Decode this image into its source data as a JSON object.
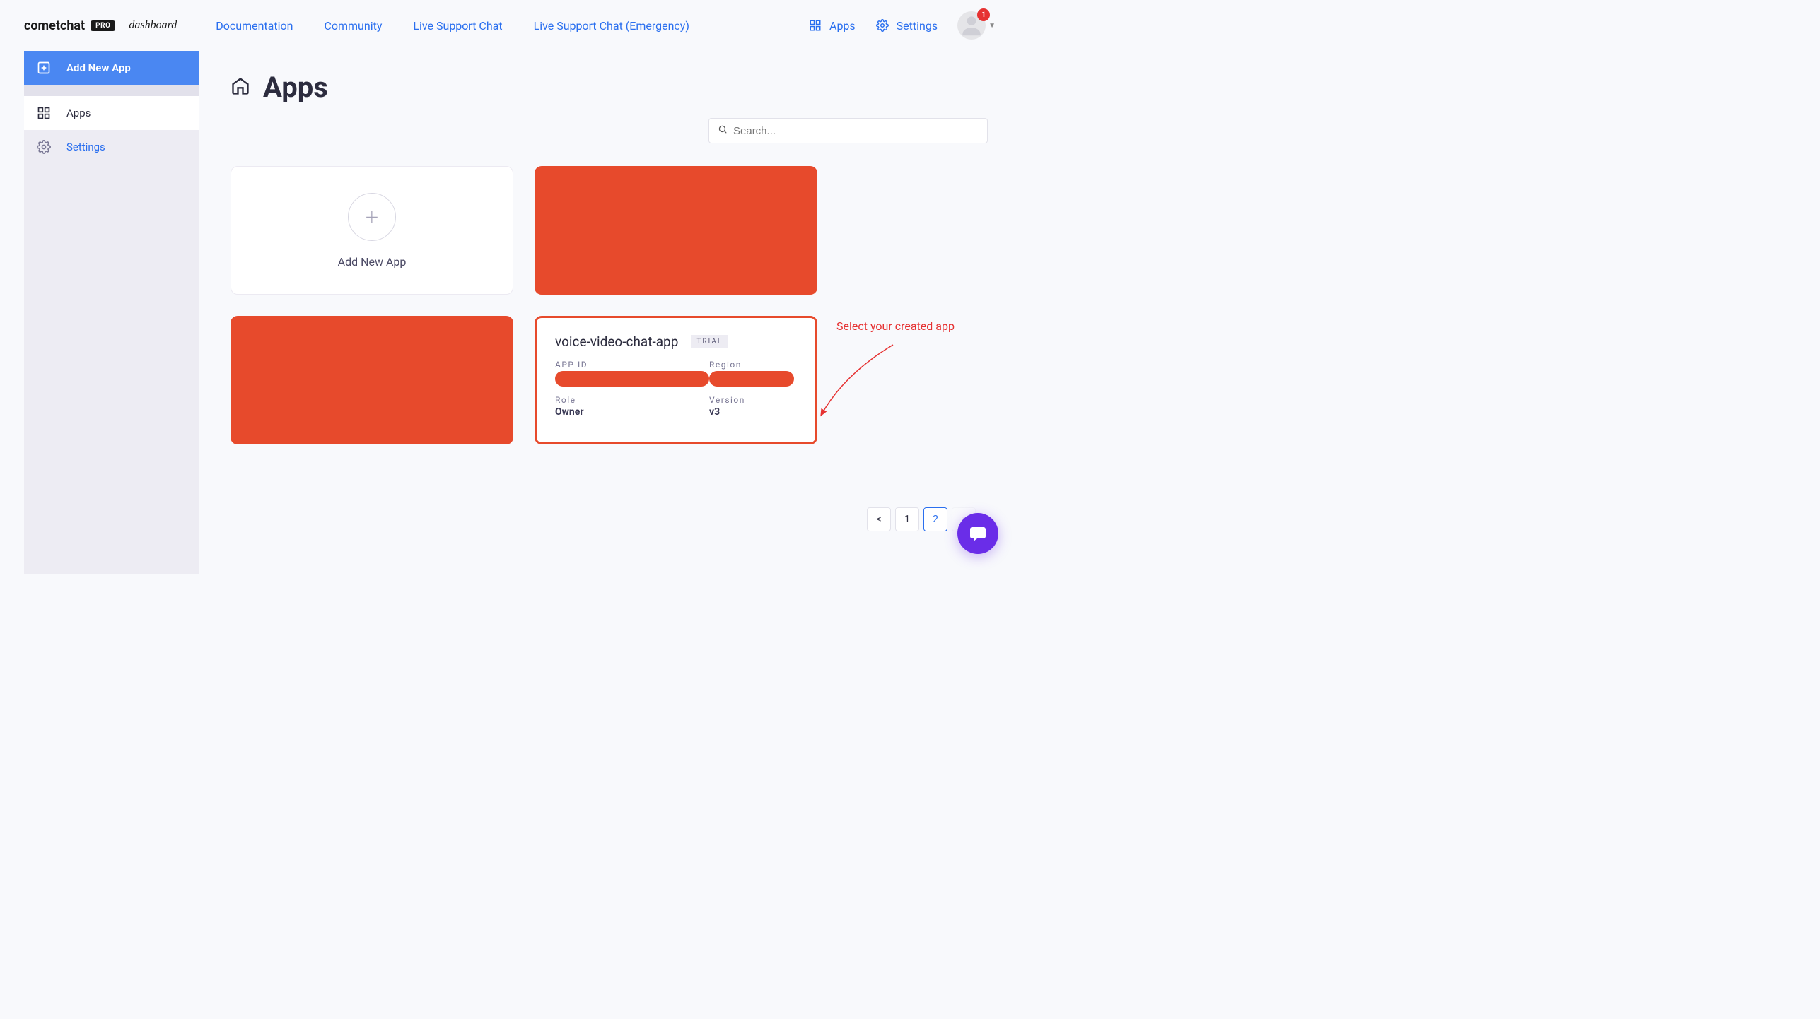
{
  "header": {
    "logo_brand": "cometchat",
    "logo_pro": "PRO",
    "logo_dashboard": "dashboard",
    "nav": [
      "Documentation",
      "Community",
      "Live Support Chat",
      "Live Support Chat (Emergency)"
    ],
    "apps_label": "Apps",
    "settings_label": "Settings",
    "notif_count": "1"
  },
  "sidebar": {
    "add_label": "Add New App",
    "apps_label": "Apps",
    "settings_label": "Settings"
  },
  "page": {
    "title": "Apps"
  },
  "search": {
    "placeholder": "Search..."
  },
  "cards": {
    "add_label": "Add New App",
    "app": {
      "name": "voice-video-chat-app",
      "badge": "TRIAL",
      "app_id_label": "APP ID",
      "region_label": "Region",
      "role_label": "Role",
      "role_value": "Owner",
      "version_label": "Version",
      "version_value": "v3"
    }
  },
  "annotation": {
    "text": "Select your created app"
  },
  "pagination": {
    "prev": "<",
    "p1": "1",
    "p2": "2"
  },
  "colors": {
    "accent": "#2a6fef",
    "danger": "#e74a2c",
    "chat": "#6a2de8"
  }
}
